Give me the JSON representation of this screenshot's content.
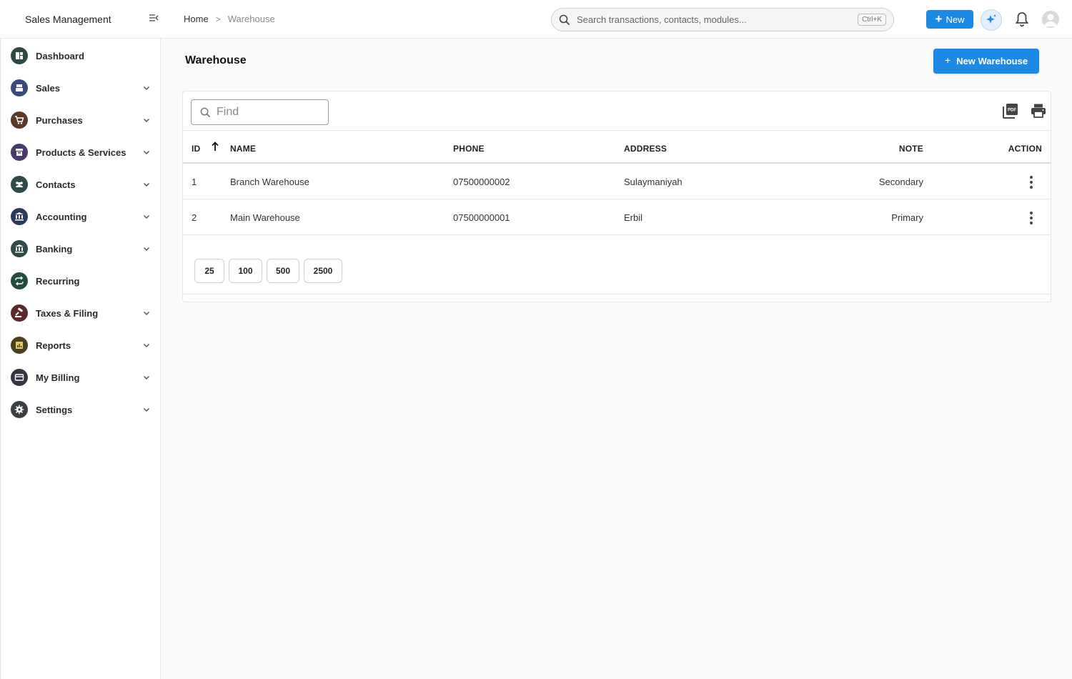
{
  "header": {
    "app_title": "Sales Management",
    "breadcrumb_home": "Home",
    "breadcrumb_separator": ">",
    "breadcrumb_current": "Warehouse",
    "search_placeholder": "Search transactions, contacts, modules...",
    "search_shortcut": "Ctrl+K",
    "new_button": "New",
    "accent": "#1e88e5"
  },
  "sidebar": {
    "items": [
      {
        "label": "Dashboard",
        "icon": "dashboard-icon",
        "color": "#2e4a44",
        "has_children": false
      },
      {
        "label": "Sales",
        "icon": "cash-register-icon",
        "color": "#3b4a7a",
        "has_children": true
      },
      {
        "label": "Purchases",
        "icon": "cart-icon",
        "color": "#5a3a26",
        "has_children": true
      },
      {
        "label": "Products & Services",
        "icon": "box-icon",
        "color": "#4a3a6a",
        "has_children": true
      },
      {
        "label": "Contacts",
        "icon": "people-icon",
        "color": "#2f4a48",
        "has_children": true
      },
      {
        "label": "Accounting",
        "icon": "bank-icon",
        "color": "#2a3a5a",
        "has_children": true
      },
      {
        "label": "Banking",
        "icon": "bank-building-icon",
        "color": "#2f4a48",
        "has_children": true
      },
      {
        "label": "Recurring",
        "icon": "repeat-icon",
        "color": "#254a40",
        "has_children": false
      },
      {
        "label": "Taxes & Filing",
        "icon": "gavel-icon",
        "color": "#5a2a2a",
        "has_children": true
      },
      {
        "label": "Reports",
        "icon": "report-icon",
        "color": "#4a4020",
        "has_children": true
      },
      {
        "label": "My Billing",
        "icon": "billing-icon",
        "color": "#333840",
        "has_children": true
      },
      {
        "label": "Settings",
        "icon": "gear-icon",
        "color": "#3a3f44",
        "has_children": true
      }
    ]
  },
  "page": {
    "title": "Warehouse",
    "new_button": "New Warehouse",
    "find_placeholder": "Find"
  },
  "table": {
    "columns": [
      "ID",
      "NAME",
      "PHONE",
      "ADDRESS",
      "NOTE",
      "ACTION"
    ],
    "rows": [
      {
        "id": "1",
        "name": "Branch Warehouse",
        "phone": "07500000002",
        "address": "Sulaymaniyah",
        "note": "Secondary"
      },
      {
        "id": "2",
        "name": "Main Warehouse",
        "phone": "07500000001",
        "address": "Erbil",
        "note": "Primary"
      }
    ],
    "page_sizes": [
      "25",
      "100",
      "500",
      "2500"
    ]
  }
}
